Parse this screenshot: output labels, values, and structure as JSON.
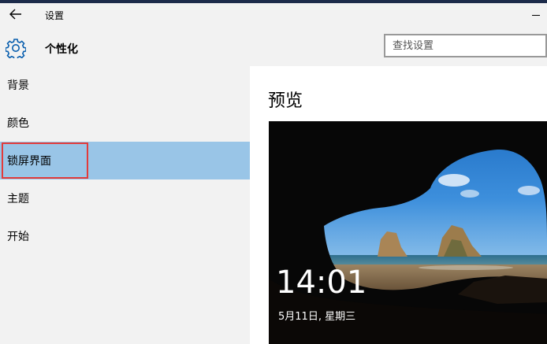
{
  "window": {
    "title": "设置"
  },
  "header": {
    "section_title": "个性化",
    "search_placeholder": "查找设置"
  },
  "sidebar": {
    "items": [
      {
        "label": "背景"
      },
      {
        "label": "颜色"
      },
      {
        "label": "锁屏界面",
        "selected": true
      },
      {
        "label": "主题"
      },
      {
        "label": "开始"
      }
    ]
  },
  "main": {
    "preview_title": "预览",
    "lockscreen": {
      "time": "14:01",
      "date": "5月11日, 星期三"
    }
  },
  "colors": {
    "accent": "#99c5e7",
    "highlight_border": "#e23b3b",
    "gear": "#0a5fae"
  },
  "icons": [
    "back-arrow-icon",
    "gear-icon",
    "minimize-icon"
  ]
}
